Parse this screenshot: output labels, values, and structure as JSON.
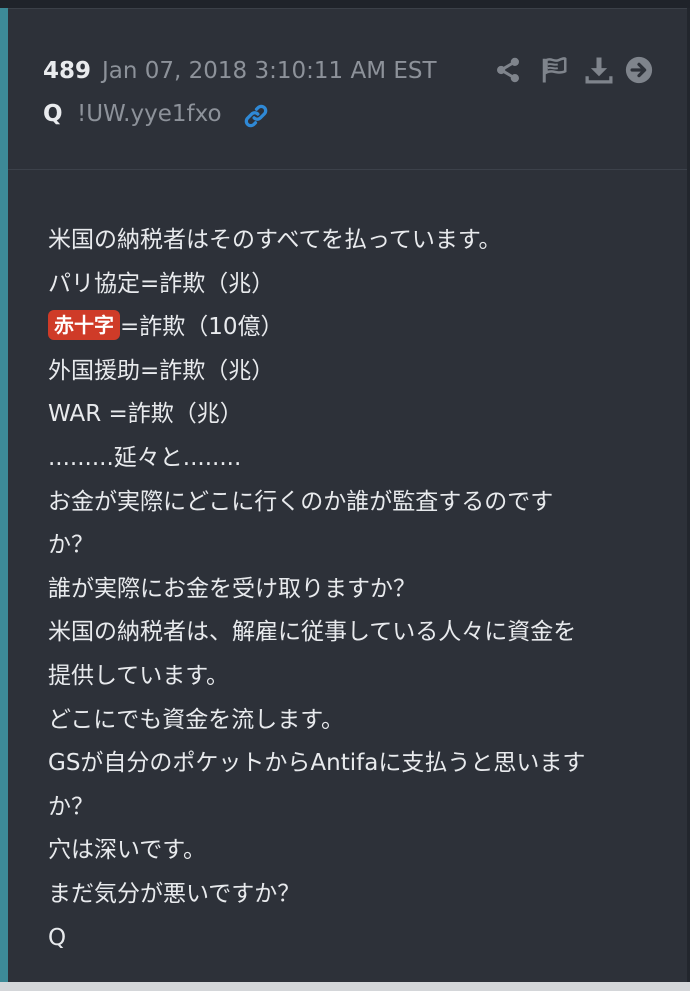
{
  "post": {
    "number": "489",
    "date": "Jan 07, 2018 3:10:11 AM EST",
    "author": "Q",
    "tripcode": "!UW.yye1fxo",
    "actions": [
      "share-icon",
      "flag-icon",
      "download-icon",
      "arrow-right-circle-icon"
    ],
    "colors": {
      "accent": "#3d8a97",
      "card": "#2d3139",
      "tag": "#cf3b28",
      "link": "#2f89d6"
    },
    "lines": [
      {
        "text": "米国の納税者はそのすべてを払っています。"
      },
      {
        "text": "パリ協定=詐欺（兆）"
      },
      {
        "tag": "赤十字",
        "text": "=詐欺（10億）"
      },
      {
        "text": "外国援助=詐欺（兆）"
      },
      {
        "text": "WAR =詐欺（兆）"
      },
      {
        "text": ".........延々と........"
      },
      {
        "text": "お金が実際にどこに行くのか誰が監査するのです"
      },
      {
        "text": "か？"
      },
      {
        "text": "誰が実際にお金を受け取りますか？"
      },
      {
        "text": "米国の納税者は、解雇に従事している人々に資金を"
      },
      {
        "text": "提供しています。"
      },
      {
        "text": "どこにでも資金を流します。"
      },
      {
        "text": "GSが自分のポケットからAntifaに支払うと思います"
      },
      {
        "text": "か？"
      },
      {
        "text": "穴は深いです。"
      },
      {
        "text": "まだ気分が悪いですか？"
      },
      {
        "text": "Q"
      }
    ]
  }
}
